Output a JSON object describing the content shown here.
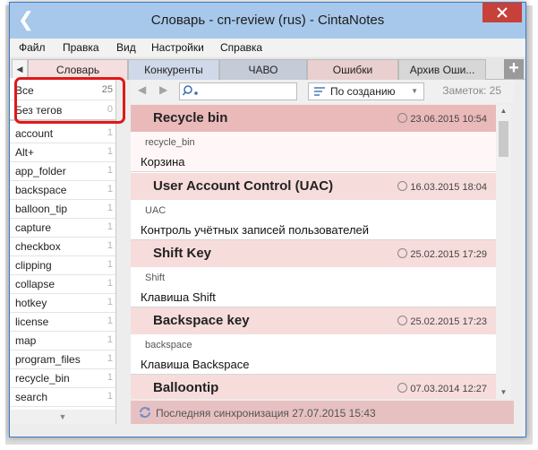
{
  "window": {
    "title": "Словарь - cn-review (rus) - CintaNotes"
  },
  "menu": [
    "Файл",
    "Правка",
    "Вид",
    "Настройки",
    "Справка"
  ],
  "tabs": [
    {
      "label": "Словарь",
      "color": "#f5dede",
      "active": true
    },
    {
      "label": "Конкуренты",
      "color": "#cfd9e9"
    },
    {
      "label": "ЧАВО",
      "color": "#c6cbd8"
    },
    {
      "label": "Ошибки",
      "color": "#e9cfcf"
    },
    {
      "label": "Архив Оши...",
      "color": "#d7d7d7"
    }
  ],
  "sidebar": {
    "items": [
      {
        "label": "Все",
        "count": "25"
      },
      {
        "label": "Без тегов",
        "count": "0"
      },
      {
        "label": "account",
        "count": "1"
      },
      {
        "label": "Alt+",
        "count": "1"
      },
      {
        "label": "app_folder",
        "count": "1"
      },
      {
        "label": "backspace",
        "count": "1"
      },
      {
        "label": "balloon_tip",
        "count": "1"
      },
      {
        "label": "capture",
        "count": "1"
      },
      {
        "label": "checkbox",
        "count": "1"
      },
      {
        "label": "clipping",
        "count": "1"
      },
      {
        "label": "collapse",
        "count": "1"
      },
      {
        "label": "hotkey",
        "count": "1"
      },
      {
        "label": "license",
        "count": "1"
      },
      {
        "label": "map",
        "count": "1"
      },
      {
        "label": "program_files",
        "count": "1"
      },
      {
        "label": "recycle_bin",
        "count": "1"
      },
      {
        "label": "search",
        "count": "1"
      }
    ]
  },
  "toolbar": {
    "sort_value": "По созданию",
    "notes_count": "Заметок: 25"
  },
  "notes": [
    {
      "title": "Recycle bin",
      "date": "23.06.2015 10:54",
      "tag": "recycle_bin",
      "body": "Корзина",
      "selected": true
    },
    {
      "title": "User Account Control (UAC)",
      "date": "16.03.2015 18:04",
      "tag": "UAC",
      "body": "Контроль учётных записей пользователей"
    },
    {
      "title": "Shift Key",
      "date": "25.02.2015 17:29",
      "tag": "Shift",
      "body": "Клавиша Shift"
    },
    {
      "title": "Backspace key",
      "date": "25.02.2015 17:23",
      "tag": "backspace",
      "body": "Клавиша Backspace"
    },
    {
      "title": "Balloontip",
      "date": "07.03.2014 12:27",
      "tag": "",
      "body": ""
    }
  ],
  "status": {
    "text": "Последняя синхронизация 27.07.2015 15:43"
  },
  "colors": {
    "titlebar": "#a7c8ea",
    "close": "#c7403a",
    "note_header": "#f7dcdc",
    "note_header_selected": "#eab9b9",
    "statusbar": "#e7c1c1",
    "highlight": "#e01818"
  }
}
